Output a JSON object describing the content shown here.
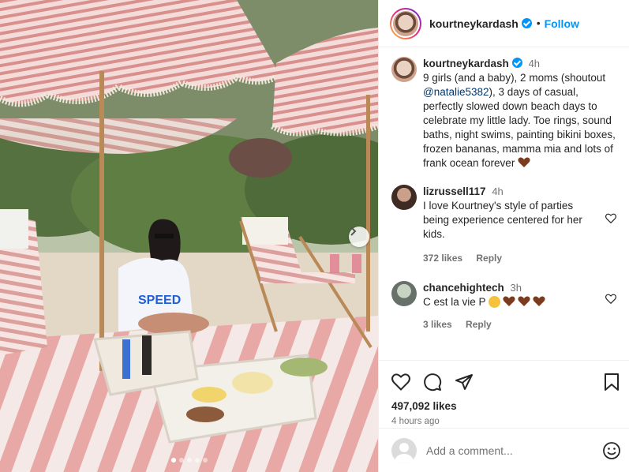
{
  "post": {
    "author": "kourtneykardash",
    "follow_label": "Follow",
    "separator": "•",
    "caption": {
      "username": "kourtneykardash",
      "time": "4h",
      "text_before": "9 girls (and a baby), 2 moms (shoutout ",
      "mention": "@natalie5382",
      "text_after": "), 3 days of casual, perfectly slowed down beach days to celebrate my little lady. Toe rings, sound baths, night swims, painting bikini boxes, frozen bananas, mamma mia and lots of frank ocean forever "
    },
    "comments": [
      {
        "username": "lizrussell117",
        "time": "4h",
        "text": "I love Kourtney's style of parties being experience centered for her kids.",
        "likes": "372 likes",
        "reply_label": "Reply"
      },
      {
        "username": "chancehightech",
        "time": "3h",
        "text": "C est la vie P ",
        "likes": "3 likes",
        "reply_label": "Reply"
      }
    ],
    "likes_count": "497,092 likes",
    "posted_ago": "4 hours ago",
    "add_comment_placeholder": "Add a comment...",
    "carousel": {
      "slides": 5,
      "active": 0
    }
  },
  "colors": {
    "link_blue": "#0095f6",
    "mention_blue": "#00376b",
    "muted_gray": "#737373",
    "heart_brown": "#7a3b1e"
  },
  "icons": [
    "heart-icon",
    "comment-icon",
    "share-icon",
    "bookmark-icon",
    "emoji-icon",
    "chevron-right-icon",
    "more-icon",
    "verified-icon"
  ]
}
